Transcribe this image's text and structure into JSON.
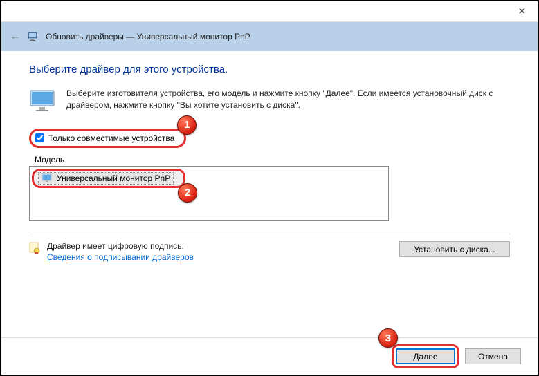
{
  "titlebar": {
    "close_label": "✕"
  },
  "header": {
    "back_glyph": "←",
    "title": "Обновить драйверы — Универсальный монитор PnP"
  },
  "content": {
    "heading": "Выберите драйвер для этого устройства.",
    "instruction": "Выберите изготовителя устройства, его модель и нажмите кнопку \"Далее\". Если имеется установочный диск с  драйвером, нажмите кнопку \"Вы хотите установить с диска\"."
  },
  "checkbox": {
    "label": "Только совместимые устройства",
    "checked": true
  },
  "model": {
    "header": "Модель",
    "items": [
      "Универсальный монитор PnP"
    ]
  },
  "signature": {
    "line1": "Драйвер имеет цифровую подпись.",
    "link": "Сведения о подписывании драйверов"
  },
  "buttons": {
    "install_disk": "Установить с диска...",
    "next": "Далее",
    "cancel": "Отмена"
  },
  "badges": {
    "b1": "1",
    "b2": "2",
    "b3": "3"
  }
}
